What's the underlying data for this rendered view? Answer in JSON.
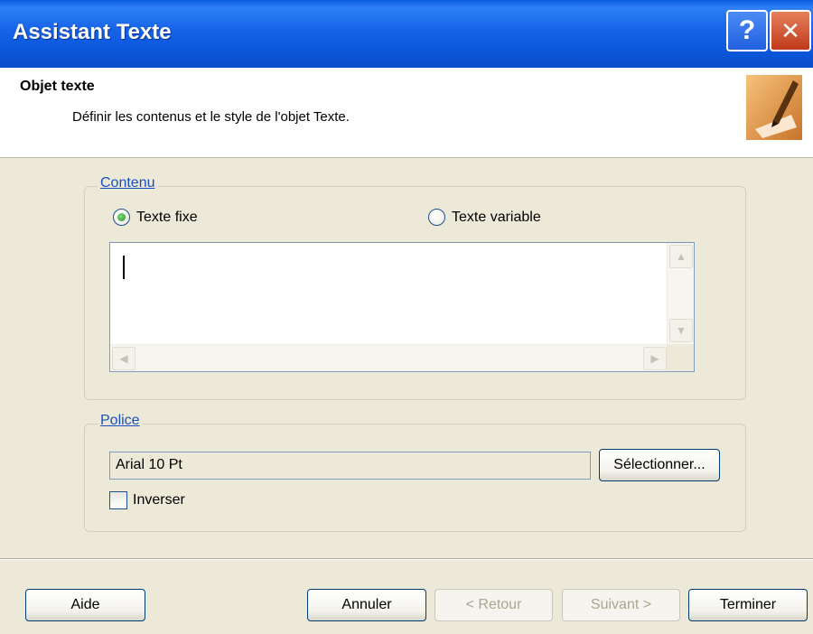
{
  "window": {
    "title": "Assistant Texte",
    "help_glyph": "?",
    "close_glyph": "✕"
  },
  "header": {
    "title": "Objet texte",
    "subtitle": "Définir les contenus et le style de l'objet Texte.",
    "icon": "pen-writing-icon"
  },
  "content_group": {
    "legend": "Contenu",
    "radio_fixed": {
      "label": "Texte fixe",
      "selected": true
    },
    "radio_variable": {
      "label": "Texte variable",
      "selected": false
    },
    "text_value": ""
  },
  "font_group": {
    "legend": "Police",
    "font_value": "Arial 10 Pt",
    "select_button": "Sélectionner...",
    "invert_checkbox": {
      "label": "Inverser",
      "checked": false
    }
  },
  "footer": {
    "help": "Aide",
    "cancel": "Annuler",
    "back": "< Retour",
    "next": "Suivant >",
    "finish": "Terminer"
  },
  "scroll_glyphs": {
    "up": "▲",
    "down": "▼",
    "left": "◀",
    "right": "▶"
  }
}
